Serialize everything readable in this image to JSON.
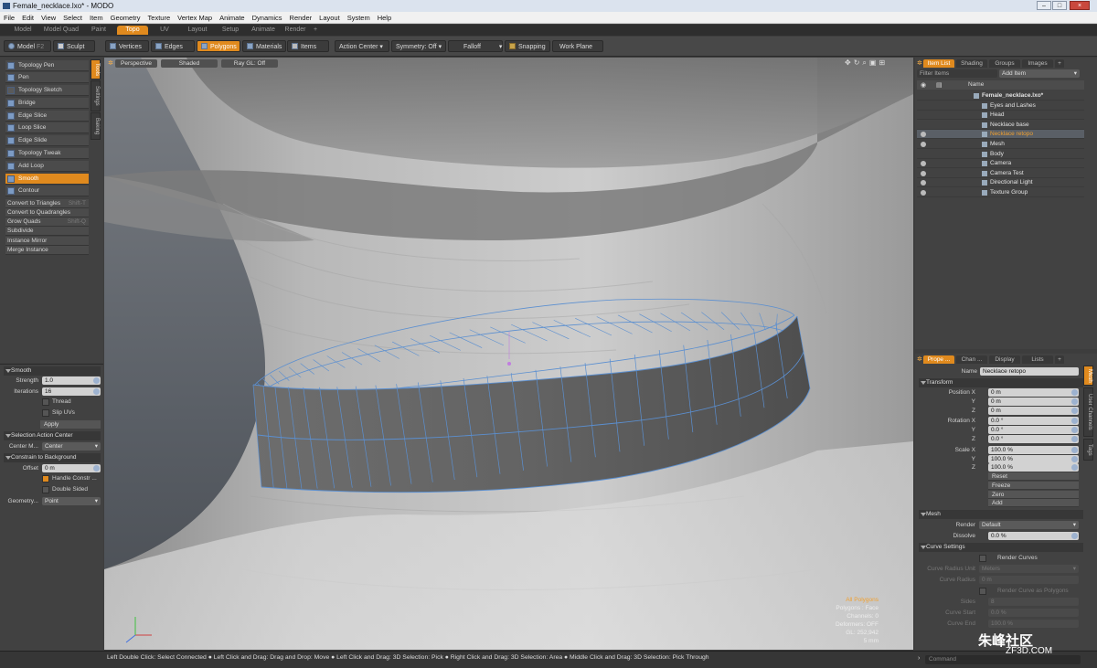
{
  "window": {
    "title": "Female_necklace.lxo* - MODO",
    "controls": [
      "–",
      "□",
      "×"
    ]
  },
  "menu": [
    "File",
    "Edit",
    "View",
    "Select",
    "Item",
    "Geometry",
    "Texture",
    "Vertex Map",
    "Animate",
    "Dynamics",
    "Render",
    "Layout",
    "System",
    "Help"
  ],
  "layout_tabs": [
    "Model",
    "Model Quad",
    "Paint",
    "Topo",
    "UV",
    "Layout",
    "Setup",
    "Animate",
    "Render",
    "+"
  ],
  "toolbar": {
    "model": "Model",
    "model_key": "F2",
    "sculpt": "Sculpt",
    "vertices": "Vertices",
    "edges": "Edges",
    "polygons": "Polygons",
    "materials": "Materials",
    "items": "Items",
    "action_center": "Action Center",
    "symmetry": "Symmetry: Off",
    "falloff": "Falloff",
    "snapping": "Snapping",
    "work_plane": "Work Plane"
  },
  "tools": {
    "items": [
      "Topology Pen",
      "Pen",
      "Topology Sketch",
      "Bridge",
      "Edge Slice",
      "Loop Slice",
      "Edge Slide",
      "Topology Tweak",
      "Add Loop",
      "Smooth",
      "Contour"
    ],
    "commands": [
      {
        "label": "Convert to Triangles",
        "shortcut": "Shift-T"
      },
      {
        "label": "Convert to Quadrangles",
        "shortcut": ""
      },
      {
        "label": "Grow Quads",
        "shortcut": "Shift-Q"
      },
      {
        "label": "Subdivide",
        "shortcut": ""
      },
      {
        "label": "Instance Mirror",
        "shortcut": ""
      },
      {
        "label": "Merge Instance",
        "shortcut": ""
      }
    ],
    "side_tabs": [
      "Tools",
      "Settings",
      "Baking"
    ]
  },
  "smooth": {
    "header": "Smooth",
    "strength_label": "Strength",
    "strength": "1.0",
    "iterations_label": "Iterations",
    "iterations": "16",
    "thread": "Thread",
    "slip_uvs": "Slip UVs",
    "apply": "Apply",
    "action_center_header": "Selection Action Center",
    "center_mode_label": "Center M...",
    "center_mode": "Center",
    "constrain_header": "Constrain to Background",
    "offset_label": "Offset",
    "offset": "0 m",
    "handle_constr": "Handle Constr ...",
    "double_sided": "Double Sided",
    "geometry_label": "Geometry...",
    "geometry": "Point"
  },
  "viewport": {
    "view": "Perspective",
    "shading": "Shaded",
    "raygl": "Ray GL: Off",
    "info": [
      "All Polygons",
      "Polygons : Face",
      "Channels: 0",
      "Deformers: OFF",
      "GL: 252,942",
      "5 mm"
    ],
    "nav_icons": [
      "move-icon",
      "rotate-icon",
      "zoom-icon",
      "fit-icon",
      "maximize-icon"
    ]
  },
  "item_list": {
    "tabs": [
      "Item List",
      "Shading",
      "Groups",
      "Images",
      "+"
    ],
    "filter_placeholder": "Filter Items",
    "add_item": "Add Item",
    "column_name": "Name",
    "items": [
      {
        "label": "Female_necklace.lxo*",
        "depth": 0,
        "eye": false,
        "bold": true
      },
      {
        "label": "Eyes and Lashes",
        "depth": 1,
        "eye": false
      },
      {
        "label": "Head",
        "depth": 1,
        "eye": false
      },
      {
        "label": "Necklace base",
        "depth": 1,
        "eye": false
      },
      {
        "label": "Necklace retopo",
        "depth": 1,
        "eye": true,
        "selected": true
      },
      {
        "label": "Mesh",
        "depth": 1,
        "eye": true
      },
      {
        "label": "Body",
        "depth": 1,
        "eye": false
      },
      {
        "label": "Camera",
        "depth": 1,
        "eye": true
      },
      {
        "label": "Camera Test",
        "depth": 1,
        "eye": true
      },
      {
        "label": "Directional Light",
        "depth": 1,
        "eye": true
      },
      {
        "label": "Texture Group",
        "depth": 1,
        "eye": true
      }
    ]
  },
  "properties": {
    "tabs": [
      "Prope ...",
      "Chan ...",
      "Display",
      "Lists",
      "+"
    ],
    "side_tabs": [
      "Mesh",
      "User Channels",
      "Tags"
    ],
    "name_label": "Name",
    "name": "Necklace retopo",
    "transform_header": "Transform",
    "position_label": "Position",
    "rotation_label": "Rotation",
    "scale_label": "Scale",
    "axes": [
      "X",
      "Y",
      "Z"
    ],
    "position": [
      "0 m",
      "0 m",
      "0 m"
    ],
    "rotation": [
      "0.0 °",
      "0.0 °",
      "0.0 °"
    ],
    "scale": [
      "100.0 %",
      "100.0 %",
      "100.0 %"
    ],
    "actions": [
      "Reset",
      "Freeze",
      "Zero",
      "Add"
    ],
    "mesh_header": "Mesh",
    "render_label": "Render",
    "render": "Default",
    "dissolve_label": "Dissolve",
    "dissolve": "0.0 %",
    "curve_header": "Curve Settings",
    "render_curves": "Render Curves",
    "curve_radius_unit_label": "Curve Radius Unit",
    "curve_radius_unit": "Meters",
    "curve_radius_label": "Curve Radius",
    "curve_radius": "0 m",
    "render_curve_polys": "Render Curve as Polygons",
    "sides_label": "Sides",
    "sides": "8",
    "curve_start_label": "Curve Start",
    "curve_start": "0.0 %",
    "curve_end_label": "Curve End",
    "curve_end": "100.0 %"
  },
  "status": {
    "hint": "Left Double Click: Select Connected ● Left Click and Drag: Drag and Drop: Move ● Left Click and Drag: 3D Selection: Pick ● Right Click and Drag: 3D Selection: Area ● Middle Click and Drag: 3D Selection: Pick Through",
    "command_placeholder": "Command"
  },
  "watermark": {
    "main": "朱峰社区",
    "sub": "ZF3D.COM"
  },
  "colors": {
    "accent": "#e08a1e",
    "wire": "#5b8fd0"
  }
}
